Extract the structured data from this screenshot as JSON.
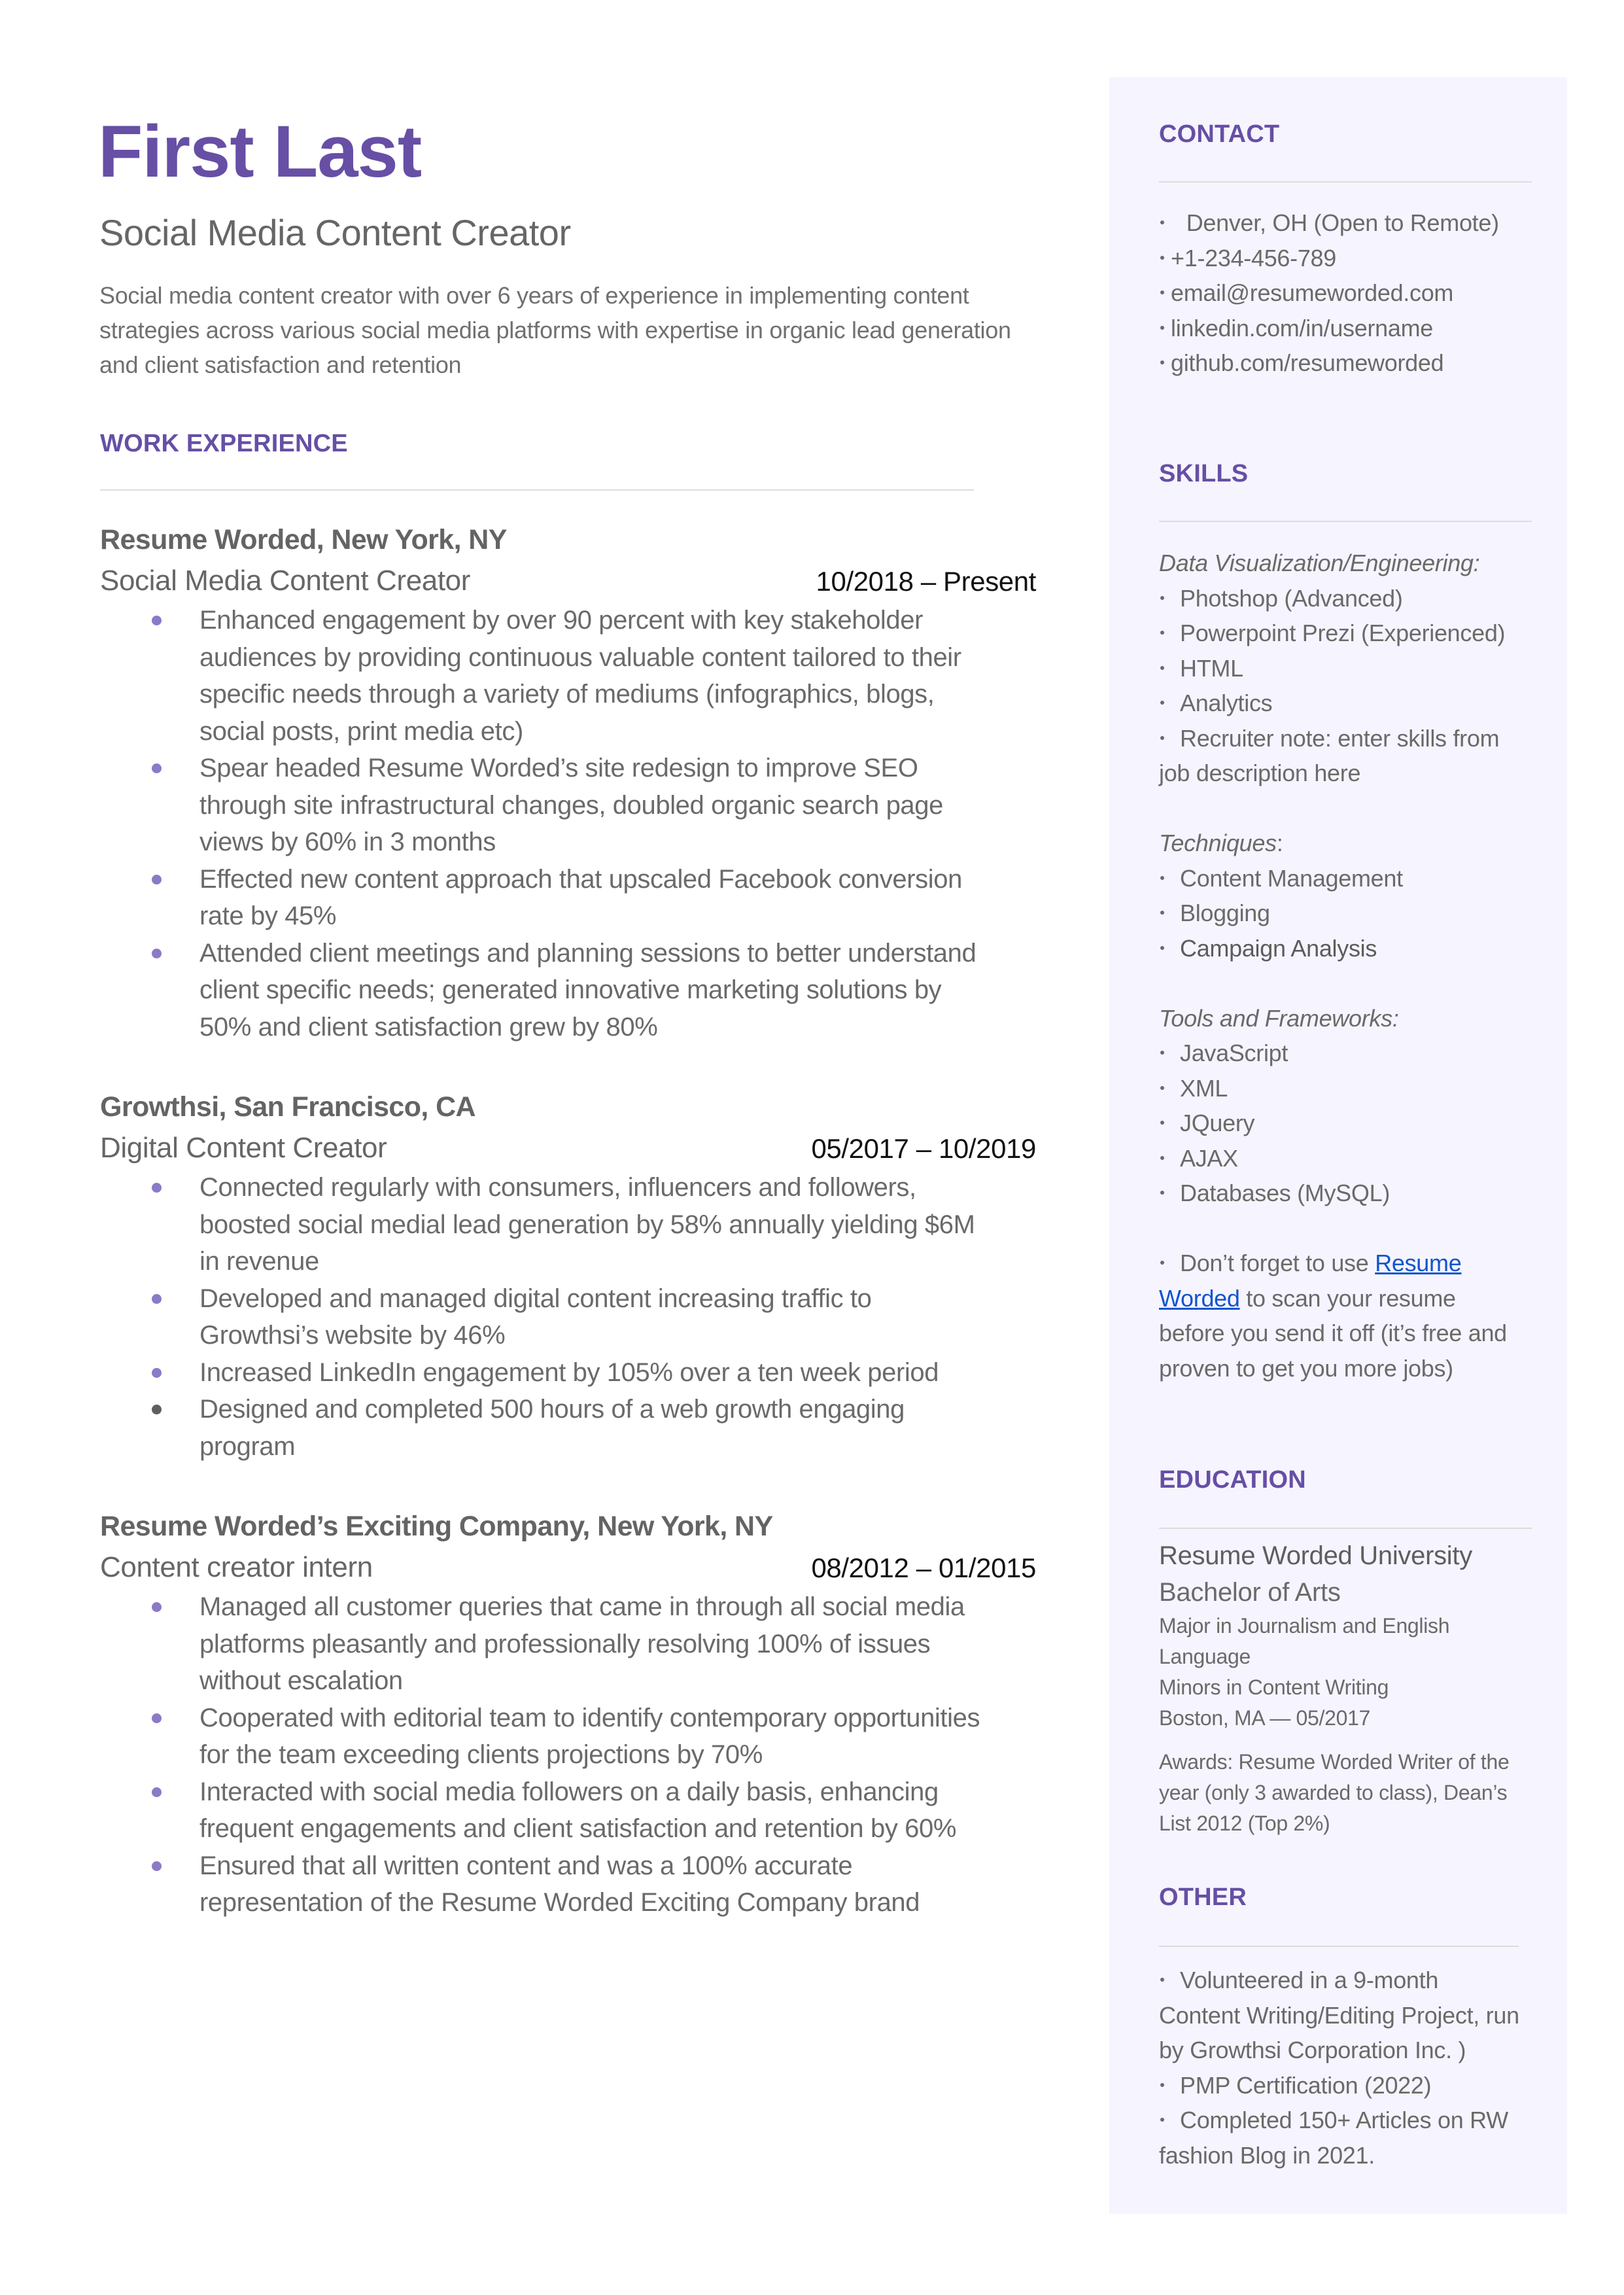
{
  "header": {
    "name": "First Last",
    "title": "Social Media Content Creator",
    "summary_lines": [
      "Social media content creator  with over 6 years of experience in implementing content",
      "strategies across various social media platforms with expertise in organic lead generation",
      "and client satisfaction and retention"
    ]
  },
  "colors": {
    "accent": "#664fa5",
    "bullet": "#8b7ac6",
    "sidebar_bg": "#f6f4fe",
    "link": "#1155cc",
    "text": "#6a6a6a"
  },
  "work": {
    "heading": "WORK EXPERIENCE",
    "jobs": [
      {
        "company": "Resume Worded, New York, NY",
        "role": "Social Media Content Creator",
        "dates": "10/2018 – Present",
        "bullets": [
          [
            "Enhanced engagement by over 90 percent with key stakeholder",
            "audiences by providing continuous valuable content tailored to their",
            "specific needs through a variety of mediums (infographics, blogs,",
            "social posts, print media etc)"
          ],
          [
            "Spear headed Resume Worded’s site redesign to improve SEO",
            "through site infrastructural changes, doubled organic search page",
            "views by 60% in 3 months"
          ],
          [
            "Effected new content approach that upscaled Facebook conversion",
            "rate by 45%"
          ],
          [
            "Attended client meetings and planning sessions to better understand",
            "client specific needs; generated innovative marketing solutions by",
            "50% and client satisfaction grew by 80%"
          ]
        ]
      },
      {
        "company": "Growthsi, San Francisco, CA",
        "role": "Digital Content Creator",
        "dates": "05/2017 – 10/2019",
        "bullets": [
          [
            "Connected regularly with consumers, influencers and followers,",
            "boosted social medial lead generation by 58% annually yielding $6M",
            "in revenue"
          ],
          [
            "Developed and managed digital content increasing traffic to",
            "Growthsi’s website by 46%"
          ],
          [
            "Increased LinkedIn engagement by 105% over a ten week period"
          ],
          [
            "Designed and completed 500 hours of a web growth engaging",
            "program"
          ]
        ]
      },
      {
        "company": "Resume Worded’s Exciting Company, New York, NY",
        "role": "Content creator intern",
        "dates": "08/2012 – 01/2015",
        "bullets": [
          [
            "Managed all customer queries that came in through all social media",
            "platforms pleasantly and professionally resolving 100% of issues",
            "without escalation"
          ],
          [
            "Cooperated with editorial team to identify contemporary opportunities",
            "for the team exceeding clients projections by 70%"
          ],
          [
            "Interacted with social media followers on a daily basis, enhancing",
            "frequent engagements and client satisfaction and retention by 60%"
          ],
          [
            "Ensured that all written content and was a 100% accurate",
            "representation of the Resume Worded Exciting Company brand"
          ]
        ]
      }
    ]
  },
  "sidebar": {
    "contact": {
      "heading": "CONTACT",
      "items": [
        " Denver, OH (Open to Remote)",
        "+1-234-456-789",
        "email@resumeworded.com",
        "linkedin.com/in/username",
        "github.com/resumeworded"
      ]
    },
    "skills": {
      "heading": "SKILLS",
      "groups": [
        {
          "label": "Data Visualization/Engineering:",
          "items": [
            "Photshop (Advanced)",
            "Powerpoint Prezi (Experienced)",
            "HTML",
            "Analytics"
          ],
          "note_first": "Recruiter note: enter skills from",
          "note_rest": "job description here"
        },
        {
          "label": "Techniques",
          "label_suffix": ":",
          "items": [
            "Content Management",
            "Blogging",
            "Campaign Analysis"
          ]
        },
        {
          "label": "Tools and Frameworks:",
          "items": [
            "JavaScript",
            "XML",
            "JQuery",
            "AJAX",
            "Databases (MySQL)"
          ]
        }
      ],
      "tip": {
        "before": "Don’t forget to use ",
        "link1": "Resume",
        "link2": "Worded",
        "after1": " to scan your resume",
        "after2": "before you send it off (it’s free and",
        "after3": "proven to get you more jobs)"
      }
    },
    "education": {
      "heading": "EDUCATION",
      "school": "Resume Worded University",
      "degree": "Bachelor of Arts",
      "major_line1": "Major in Journalism and English",
      "major_line2": "Language",
      "minor": "Minors in Content Writing",
      "location_date": "Boston, MA — 05/2017",
      "awards_lines": [
        "Awards: Resume Worded Writer of the",
        "year (only 3 awarded to class), Dean’s",
        "List 2012 (Top 2%)"
      ]
    },
    "other": {
      "heading": "OTHER",
      "items": [
        {
          "first": "Volunteered in a 9-month",
          "rest": [
            "Content Writing/Editing Project, run",
            "by Growthsi Corporation Inc. )"
          ]
        },
        {
          "first": "PMP Certification (2022)",
          "rest": []
        },
        {
          "first": "Completed 150+ Articles on RW",
          "rest": [
            "fashion Blog in 2021."
          ]
        }
      ]
    }
  }
}
